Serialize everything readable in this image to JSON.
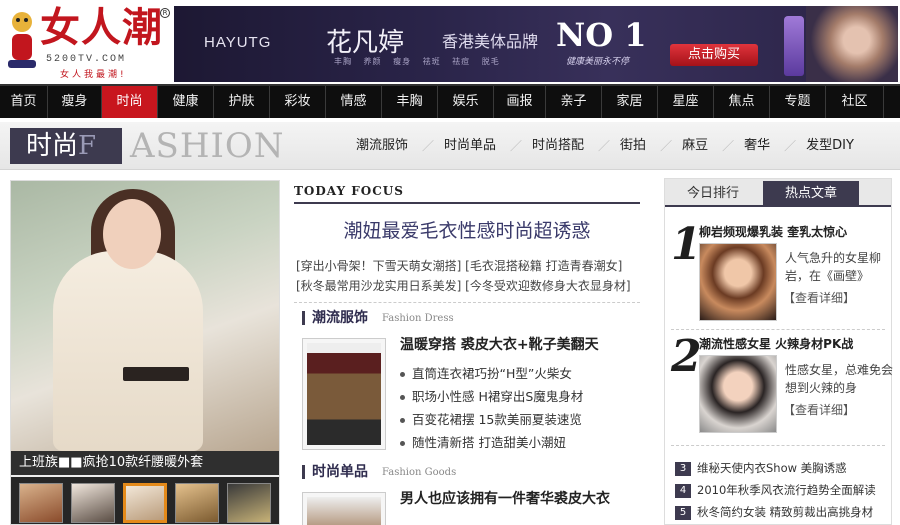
{
  "logo": {
    "brand": "女人潮",
    "reg_mark": "R",
    "domain": "5200TV.COM",
    "slogan": "女人我最潮!"
  },
  "banner": {
    "brand": "HAYUTG",
    "name": "花凡婷",
    "desc": "香港美体品牌",
    "no1": "NO 1",
    "tags": "丰胸 养颜 瘦身 祛斑 祛痘 脱毛",
    "script": "健康美丽永不停",
    "buy_label": "点击购买"
  },
  "nav": {
    "active_index": 2,
    "items": [
      "首页",
      "瘦身",
      "时尚",
      "健康",
      "护肤",
      "彩妆",
      "情感",
      "丰胸",
      "娱乐",
      "画报",
      "亲子",
      "家居",
      "星座",
      "焦点",
      "专题",
      "社区"
    ]
  },
  "section": {
    "title_cn": "时尚",
    "title_accent": "F",
    "title_en": "ASHION",
    "subnav": [
      "潮流服饰",
      "时尚单品",
      "时尚搭配",
      "街拍",
      "麻豆",
      "奢华",
      "发型DIY"
    ]
  },
  "feature": {
    "caption": "上班族■■疯抢10款纤腰暖外套",
    "thumb_count": 5,
    "active_thumb": 2
  },
  "focus": {
    "label": "TODAY FOCUS",
    "headline": "潮妞最爱毛衣性感时尚超诱惑",
    "links": [
      "[穿出小骨架！下雪天萌女潮搭] [毛衣混搭秘籍 打造青春潮女]",
      "[秋冬最常用沙龙实用日系美发] [今冬受欢迎数修身大衣显身材]"
    ]
  },
  "dress": {
    "cn": "潮流服饰",
    "en": "Fashion Dress",
    "title": "温暖穿搭 裘皮大衣+靴子美翻天",
    "items": [
      "直筒连衣裙巧扮“H型”火柴女",
      "职场小性感 H裙穿出S魔鬼身材",
      "百变花裙摆 15款美丽夏装速览",
      "随性清新搭 打造甜美小潮妞"
    ]
  },
  "goods": {
    "cn": "时尚单品",
    "en": "Fashion Goods",
    "title": "男人也应该拥有一件奢华裘皮大衣"
  },
  "rank": {
    "tab_a": "今日排行",
    "tab_b": "热点文章",
    "top1": {
      "num": "1",
      "title": "柳岩频现爆乳装 奎乳太惊心",
      "desc": "人气急升的女星柳岩，在《画壁》",
      "more": "【查看详细】"
    },
    "top2": {
      "num": "2",
      "title": "潮流性感女星 火辣身材PK战",
      "desc": "性感女星，总难免会想到火辣的身",
      "more": "【查看详细】"
    },
    "list": [
      {
        "num": "3",
        "text": "维秘天使内衣Show 美胸诱惑"
      },
      {
        "num": "4",
        "text": "2010年秋季风衣流行趋势全面解读"
      },
      {
        "num": "5",
        "text": "秋冬简约女装 精致剪裁出高挑身材"
      }
    ]
  },
  "colors": {
    "accent_red": "#c8161e",
    "theme_purple": "#3d3a4f",
    "nav_bg": "#0e0e0e"
  }
}
